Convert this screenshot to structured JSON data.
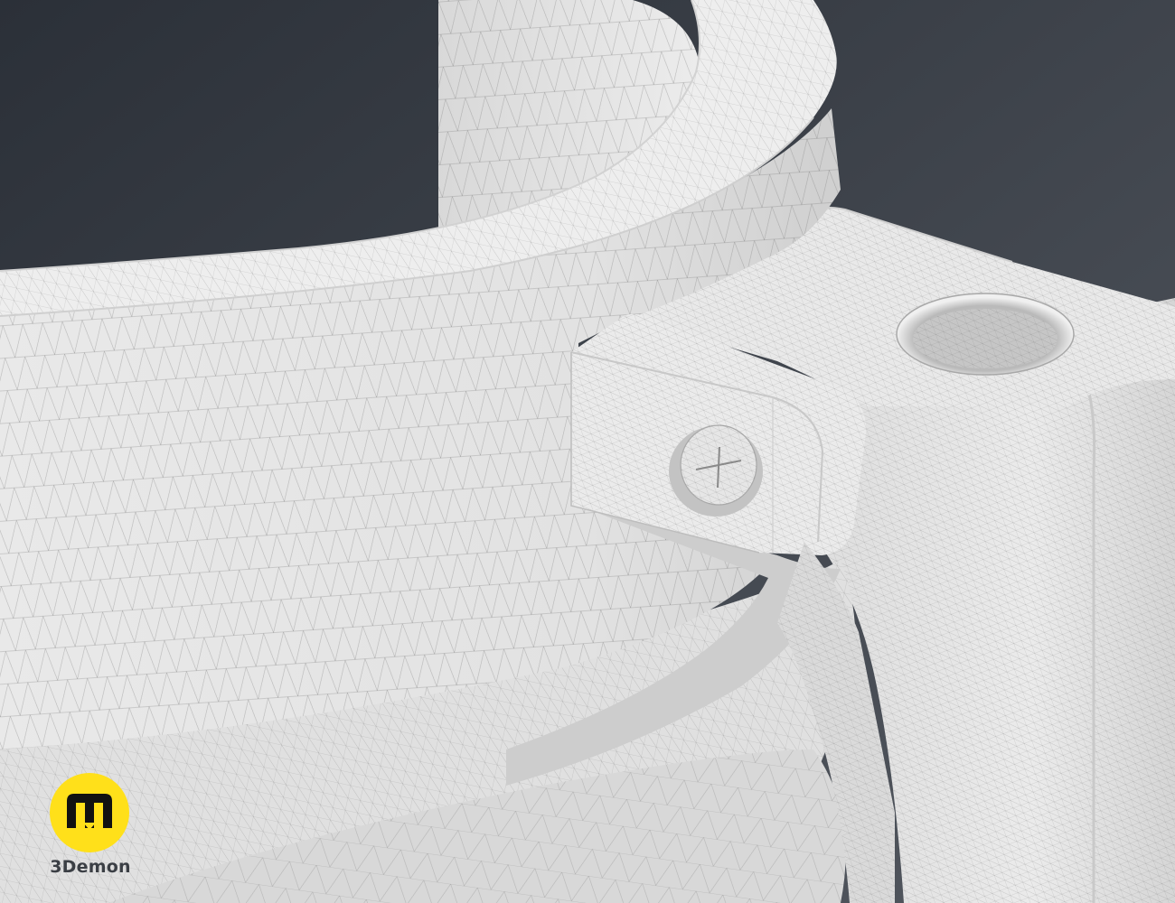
{
  "scene": {
    "subject": "3d-wireframe-render",
    "colors": {
      "background_top": "#2b3038",
      "background_bottom": "#4d525a",
      "surface": "#e7e7e7",
      "surface_shadow": "#b9b9b9",
      "wire": "#6e6e6e"
    }
  },
  "brand": {
    "name": "3Demon",
    "badge_color": "#ffe01a",
    "glyph_color": "#111111",
    "icon": "3demon-logo-icon"
  }
}
